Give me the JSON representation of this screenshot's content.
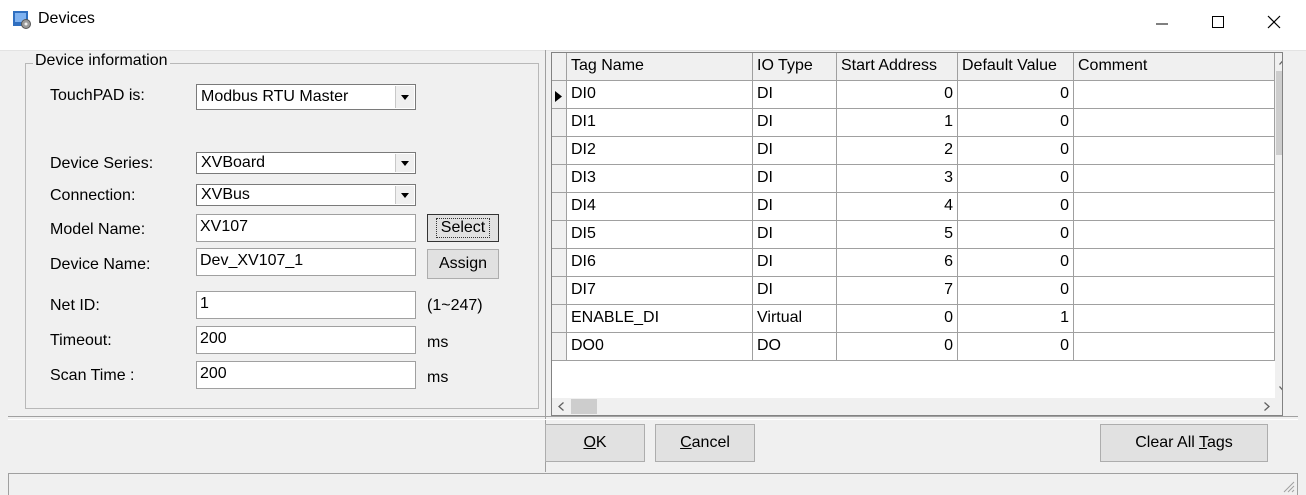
{
  "window": {
    "title": "Devices",
    "icon": "devices-app-icon",
    "controls": [
      "minimize",
      "maximize",
      "close"
    ]
  },
  "device_info": {
    "group_label": "Device information",
    "touchpad_label": "TouchPAD is:",
    "touchpad_value": "Modbus RTU Master",
    "series_label": "Device Series:",
    "series_value": "XVBoard",
    "connection_label": "Connection:",
    "connection_value": "XVBus",
    "model_label": "Model Name:",
    "model_value": "XV107",
    "select_button": "Select",
    "device_name_label": "Device Name:",
    "device_name_value": "Dev_XV107_1",
    "assign_button": "Assign",
    "netid_label": "Net ID:",
    "netid_value": "1",
    "netid_range": "(1~247)",
    "timeout_label": "Timeout:",
    "timeout_value": "200",
    "timeout_unit": "ms",
    "scantime_label": "Scan Time :",
    "scantime_value": "200",
    "scantime_unit": "ms"
  },
  "tags_grid": {
    "columns": [
      "Tag Name",
      "IO Type",
      "Start Address",
      "Default Value",
      "Comment"
    ],
    "rows": [
      {
        "name": "DI0",
        "io": "DI",
        "addr": "0",
        "def": "0",
        "comment": ""
      },
      {
        "name": "DI1",
        "io": "DI",
        "addr": "1",
        "def": "0",
        "comment": ""
      },
      {
        "name": "DI2",
        "io": "DI",
        "addr": "2",
        "def": "0",
        "comment": ""
      },
      {
        "name": "DI3",
        "io": "DI",
        "addr": "3",
        "def": "0",
        "comment": ""
      },
      {
        "name": "DI4",
        "io": "DI",
        "addr": "4",
        "def": "0",
        "comment": ""
      },
      {
        "name": "DI5",
        "io": "DI",
        "addr": "5",
        "def": "0",
        "comment": ""
      },
      {
        "name": "DI6",
        "io": "DI",
        "addr": "6",
        "def": "0",
        "comment": ""
      },
      {
        "name": "DI7",
        "io": "DI",
        "addr": "7",
        "def": "0",
        "comment": ""
      },
      {
        "name": "ENABLE_DI",
        "io": "Virtual",
        "addr": "0",
        "def": "1",
        "comment": ""
      },
      {
        "name": "DO0",
        "io": "DO",
        "addr": "0",
        "def": "0",
        "comment": ""
      }
    ]
  },
  "buttons": {
    "ok": "OK",
    "cancel": "Cancel",
    "clear_all_tags": "Clear All Tags"
  }
}
